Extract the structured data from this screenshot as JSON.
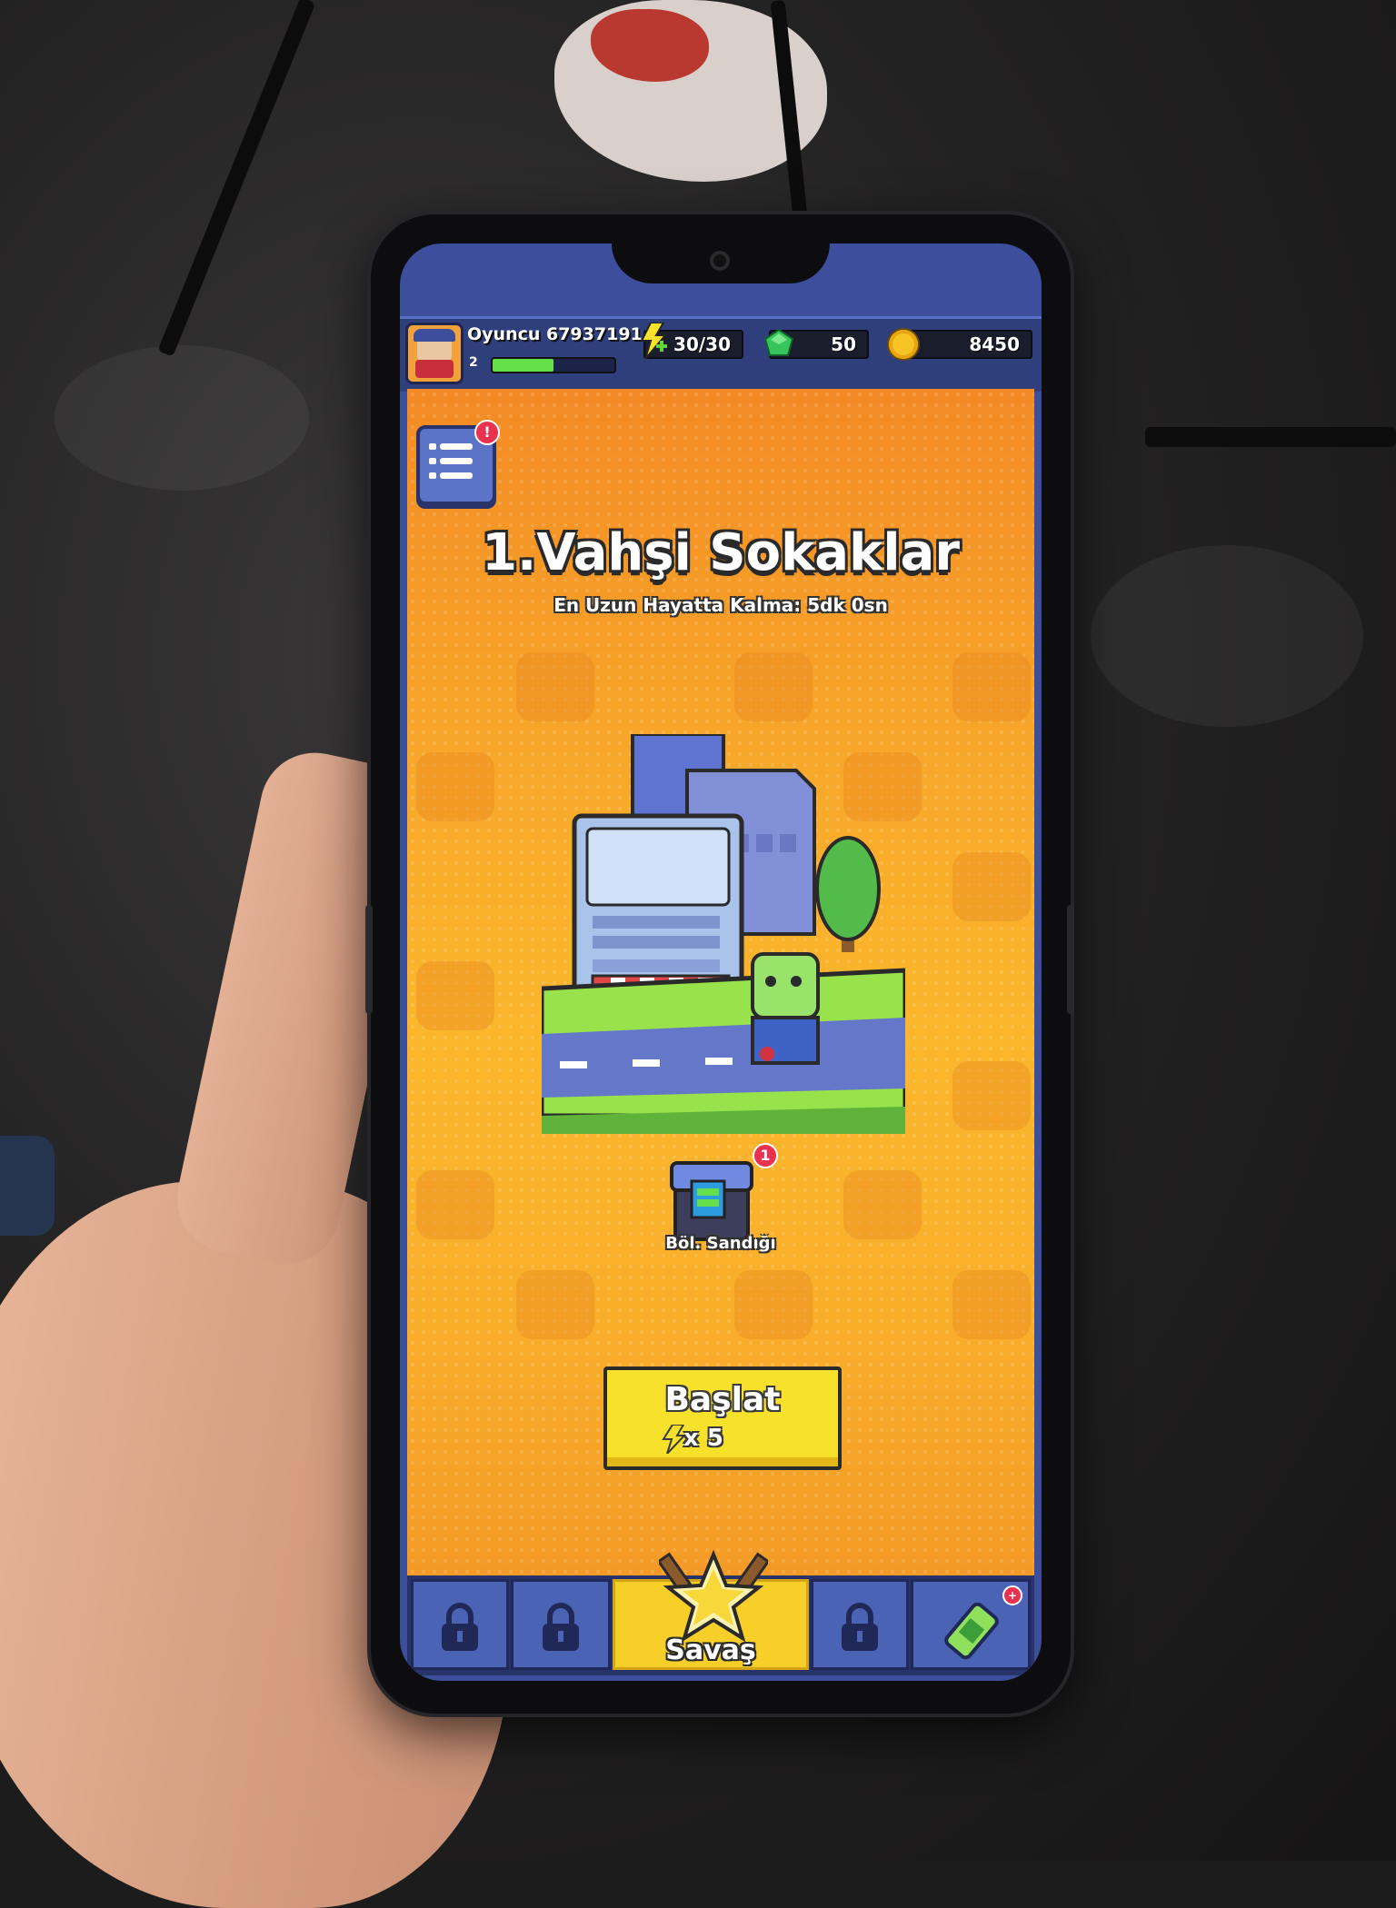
{
  "header": {
    "player_name": "Oyuncu 67937191",
    "player_level": "2",
    "xp_fraction": 0.5,
    "energy": "30/30",
    "gems": "50",
    "coins": "8450"
  },
  "stage": {
    "title": "1.Vahşi Sokaklar",
    "subtitle": "En Uzun Hayatta Kalma: 5dk 0sn",
    "chest_label": "Böl. Sandığı",
    "chest_badge": "1"
  },
  "start_button": {
    "label": "Başlat",
    "cost": "x 5"
  },
  "bottom_nav": {
    "battle_label": "Savaş"
  },
  "icons": {
    "menu": "menu-list-icon",
    "energy": "lightning-bolt-icon",
    "gem": "green-gem-icon",
    "coin": "gold-coin-icon",
    "lock": "padlock-icon",
    "battle": "crossed-swords-star-icon",
    "soda": "energy-can-icon"
  },
  "colors": {
    "game_bg": "#f7a529",
    "start_button": "#f8e12a",
    "nav_tab": "#4b63b5",
    "nav_active": "#f8cf28",
    "topbar": "#2f3f7c"
  }
}
